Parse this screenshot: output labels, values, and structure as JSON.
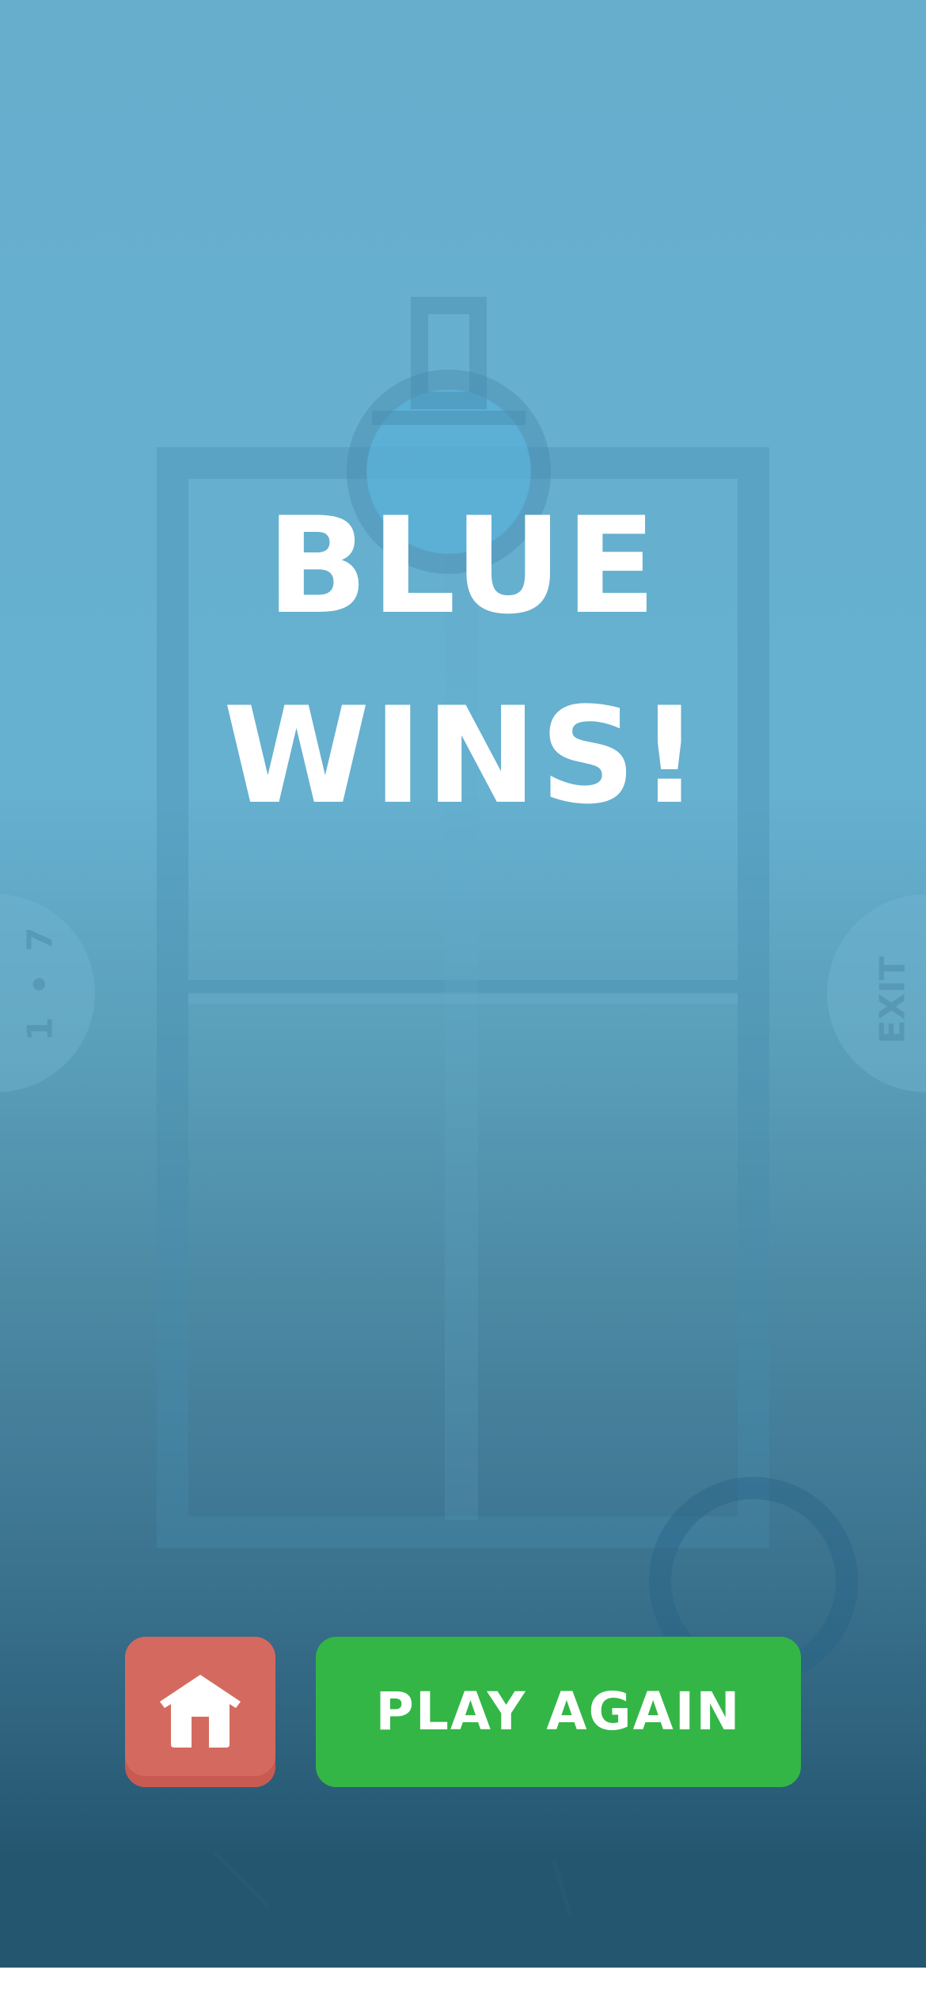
{
  "result": {
    "line1": "BLUE",
    "line2": "WINS!"
  },
  "side_tabs": {
    "score": "1 • 7",
    "exit": "EXIT"
  },
  "actions": {
    "home_icon": "home-icon",
    "play_again_label": "PLAY AGAIN"
  },
  "colors": {
    "background_top": "#67aecd",
    "background_bottom": "#24566f",
    "home_button": "#d46a5f",
    "play_again_button": "#33b646",
    "text": "#ffffff"
  }
}
